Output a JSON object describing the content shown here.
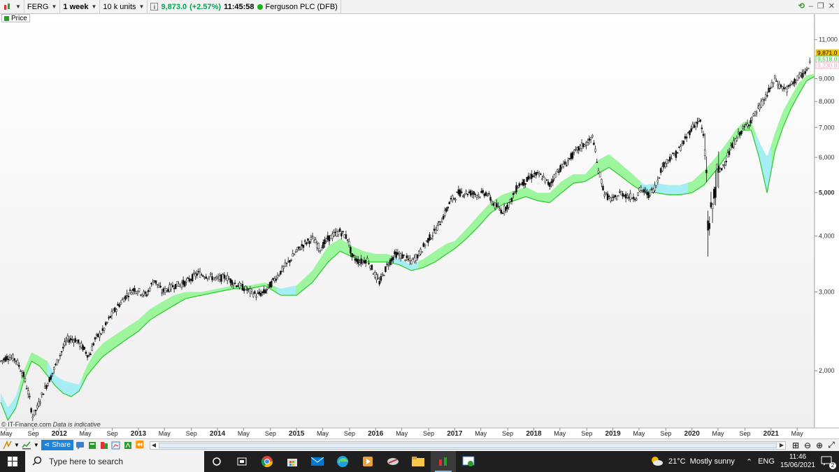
{
  "toolbar": {
    "symbol": "FERG",
    "interval": "1 week",
    "units": "10 k units",
    "info_icon": "i",
    "last_price": "9,873.0",
    "change": "(+2.57%)",
    "time": "11:45:58",
    "instrument": "Ferguson PLC (DFB)"
  },
  "legend": {
    "label": "Price"
  },
  "source": {
    "text": "© IT-Finance.com",
    "note": "Data is indicative"
  },
  "bottom": {
    "share_label": "Share"
  },
  "taskbar": {
    "search_placeholder": "Type here to search",
    "weather": "21°C  Mostly sunny",
    "language": "ENG",
    "time": "11:46",
    "date": "15/06/2021",
    "notifications": "2"
  },
  "colors": {
    "accent": "#1c84d8",
    "cloud_bull": "#8df58d",
    "cloud_bear": "#a6eef5",
    "line": "#2dc82d",
    "price_badge": "#f2c500"
  },
  "chart_data": {
    "type": "candlestick",
    "scale": "log",
    "ylim": [
      1500,
      11600
    ],
    "xlim": [
      2011.25,
      2021.55
    ],
    "ytick_values": [
      2000,
      3000,
      4000,
      5000,
      6000,
      7000,
      8000,
      9000,
      11000
    ],
    "ytick_labels": [
      "2,000",
      "3,000",
      "4,000",
      "5,000",
      "6,000",
      "7,000",
      "8,000",
      "9,000",
      "11,000"
    ],
    "price_badges": [
      {
        "label": "9,871.0",
        "value": 9871,
        "color": "#f2c500"
      },
      {
        "label": "9,518.0",
        "value": 9518,
        "color": "#2dc82d"
      },
      {
        "label": "9,230.8",
        "value": 9230,
        "color": "#f2a0c8"
      }
    ],
    "xticks": [
      {
        "label": "May",
        "x": 2011.33
      },
      {
        "label": "Sep",
        "x": 2011.67
      },
      {
        "label": "2012",
        "x": 2012.0,
        "major": true
      },
      {
        "label": "May",
        "x": 2012.33
      },
      {
        "label": "Sep",
        "x": 2012.67
      },
      {
        "label": "2013",
        "x": 2013.0,
        "major": true
      },
      {
        "label": "May",
        "x": 2013.33
      },
      {
        "label": "Sep",
        "x": 2013.67
      },
      {
        "label": "2014",
        "x": 2014.0,
        "major": true
      },
      {
        "label": "May",
        "x": 2014.33
      },
      {
        "label": "Sep",
        "x": 2014.67
      },
      {
        "label": "2015",
        "x": 2015.0,
        "major": true
      },
      {
        "label": "May",
        "x": 2015.33
      },
      {
        "label": "Sep",
        "x": 2015.67
      },
      {
        "label": "2016",
        "x": 2016.0,
        "major": true
      },
      {
        "label": "May",
        "x": 2016.33
      },
      {
        "label": "Sep",
        "x": 2016.67
      },
      {
        "label": "2017",
        "x": 2017.0,
        "major": true
      },
      {
        "label": "May",
        "x": 2017.33
      },
      {
        "label": "Sep",
        "x": 2017.67
      },
      {
        "label": "2018",
        "x": 2018.0,
        "major": true
      },
      {
        "label": "May",
        "x": 2018.33
      },
      {
        "label": "Sep",
        "x": 2018.67
      },
      {
        "label": "2019",
        "x": 2019.0,
        "major": true
      },
      {
        "label": "May",
        "x": 2019.33
      },
      {
        "label": "Sep",
        "x": 2019.67
      },
      {
        "label": "2020",
        "x": 2020.0,
        "major": true
      },
      {
        "label": "May",
        "x": 2020.33
      },
      {
        "label": "Sep",
        "x": 2020.67
      },
      {
        "label": "2021",
        "x": 2021.0,
        "major": true
      },
      {
        "label": "May",
        "x": 2021.33
      }
    ],
    "price_path": [
      [
        2011.26,
        2100
      ],
      [
        2011.35,
        2150
      ],
      [
        2011.45,
        2120
      ],
      [
        2011.55,
        1950
      ],
      [
        2011.62,
        1750
      ],
      [
        2011.66,
        1580
      ],
      [
        2011.72,
        1650
      ],
      [
        2011.8,
        1800
      ],
      [
        2011.9,
        1950
      ],
      [
        2012.0,
        2150
      ],
      [
        2012.1,
        2350
      ],
      [
        2012.2,
        2350
      ],
      [
        2012.3,
        2250
      ],
      [
        2012.38,
        2150
      ],
      [
        2012.45,
        2350
      ],
      [
        2012.55,
        2450
      ],
      [
        2012.65,
        2650
      ],
      [
        2012.75,
        2800
      ],
      [
        2012.85,
        2950
      ],
      [
        2012.95,
        3050
      ],
      [
        2013.1,
        2950
      ],
      [
        2013.2,
        3200
      ],
      [
        2013.3,
        3000
      ],
      [
        2013.45,
        3100
      ],
      [
        2013.6,
        3150
      ],
      [
        2013.75,
        3300
      ],
      [
        2013.9,
        3250
      ],
      [
        2014.0,
        3200
      ],
      [
        2014.1,
        3250
      ],
      [
        2014.2,
        3150
      ],
      [
        2014.35,
        3050
      ],
      [
        2014.5,
        2950
      ],
      [
        2014.6,
        3000
      ],
      [
        2014.75,
        3250
      ],
      [
        2014.9,
        3500
      ],
      [
        2015.0,
        3700
      ],
      [
        2015.1,
        3850
      ],
      [
        2015.2,
        3950
      ],
      [
        2015.3,
        3750
      ],
      [
        2015.4,
        3950
      ],
      [
        2015.5,
        4050
      ],
      [
        2015.55,
        4100
      ],
      [
        2015.65,
        3950
      ],
      [
        2015.7,
        3600
      ],
      [
        2015.8,
        3500
      ],
      [
        2015.9,
        3550
      ],
      [
        2016.0,
        3250
      ],
      [
        2016.05,
        3150
      ],
      [
        2016.15,
        3450
      ],
      [
        2016.25,
        3650
      ],
      [
        2016.35,
        3600
      ],
      [
        2016.45,
        3500
      ],
      [
        2016.55,
        3650
      ],
      [
        2016.65,
        3900
      ],
      [
        2016.75,
        4100
      ],
      [
        2016.85,
        4400
      ],
      [
        2016.95,
        4800
      ],
      [
        2017.05,
        5000
      ],
      [
        2017.2,
        5000
      ],
      [
        2017.3,
        4950
      ],
      [
        2017.4,
        5000
      ],
      [
        2017.5,
        4700
      ],
      [
        2017.6,
        4550
      ],
      [
        2017.7,
        4750
      ],
      [
        2017.8,
        5200
      ],
      [
        2017.9,
        5300
      ],
      [
        2018.0,
        5500
      ],
      [
        2018.1,
        5450
      ],
      [
        2018.2,
        5200
      ],
      [
        2018.3,
        5600
      ],
      [
        2018.4,
        5800
      ],
      [
        2018.5,
        6100
      ],
      [
        2018.6,
        6350
      ],
      [
        2018.7,
        6500
      ],
      [
        2018.75,
        6700
      ],
      [
        2018.8,
        5800
      ],
      [
        2018.9,
        4950
      ],
      [
        2019.0,
        4800
      ],
      [
        2019.1,
        5000
      ],
      [
        2019.2,
        4900
      ],
      [
        2019.3,
        4900
      ],
      [
        2019.35,
        5100
      ],
      [
        2019.45,
        4950
      ],
      [
        2019.55,
        5200
      ],
      [
        2019.6,
        5600
      ],
      [
        2019.7,
        5950
      ],
      [
        2019.8,
        6100
      ],
      [
        2019.9,
        6500
      ],
      [
        2020.0,
        7000
      ],
      [
        2020.1,
        7300
      ],
      [
        2020.15,
        6600
      ],
      [
        2020.18,
        5800
      ],
      [
        2020.2,
        4200
      ],
      [
        2020.25,
        4500
      ],
      [
        2020.3,
        5300
      ],
      [
        2020.4,
        5800
      ],
      [
        2020.5,
        6300
      ],
      [
        2020.6,
        6800
      ],
      [
        2020.7,
        7100
      ],
      [
        2020.8,
        7500
      ],
      [
        2020.9,
        8000
      ],
      [
        2021.0,
        8600
      ],
      [
        2021.05,
        9000
      ],
      [
        2021.1,
        8700
      ],
      [
        2021.2,
        8500
      ],
      [
        2021.3,
        8900
      ],
      [
        2021.4,
        9200
      ],
      [
        2021.48,
        9500
      ],
      [
        2021.5,
        9871
      ]
    ],
    "cloud_upper": [
      [
        2011.26,
        1780
      ],
      [
        2011.35,
        1650
      ],
      [
        2011.45,
        1750
      ],
      [
        2011.55,
        2000
      ],
      [
        2011.65,
        2200
      ],
      [
        2011.75,
        2150
      ],
      [
        2011.85,
        2100
      ],
      [
        2011.95,
        1950
      ],
      [
        2012.05,
        1900
      ],
      [
        2012.15,
        1880
      ],
      [
        2012.25,
        1860
      ],
      [
        2012.35,
        2050
      ],
      [
        2012.45,
        2200
      ],
      [
        2012.55,
        2300
      ],
      [
        2012.7,
        2400
      ],
      [
        2012.85,
        2500
      ],
      [
        2013.0,
        2600
      ],
      [
        2013.15,
        2750
      ],
      [
        2013.3,
        2850
      ],
      [
        2013.45,
        2950
      ],
      [
        2013.6,
        3000
      ],
      [
        2013.8,
        3000
      ],
      [
        2014.0,
        3050
      ],
      [
        2014.2,
        3100
      ],
      [
        2014.4,
        3100
      ],
      [
        2014.6,
        3150
      ],
      [
        2014.8,
        3050
      ],
      [
        2015.0,
        3100
      ],
      [
        2015.2,
        3350
      ],
      [
        2015.4,
        3800
      ],
      [
        2015.55,
        3950
      ],
      [
        2015.7,
        3800
      ],
      [
        2015.85,
        3700
      ],
      [
        2016.0,
        3650
      ],
      [
        2016.15,
        3650
      ],
      [
        2016.3,
        3550
      ],
      [
        2016.45,
        3450
      ],
      [
        2016.6,
        3550
      ],
      [
        2016.75,
        3700
      ],
      [
        2016.9,
        3850
      ],
      [
        2017.0,
        3900
      ],
      [
        2017.15,
        4150
      ],
      [
        2017.3,
        4450
      ],
      [
        2017.45,
        4750
      ],
      [
        2017.6,
        4950
      ],
      [
        2017.75,
        5050
      ],
      [
        2017.9,
        5150
      ],
      [
        2018.05,
        5000
      ],
      [
        2018.2,
        5000
      ],
      [
        2018.35,
        5300
      ],
      [
        2018.5,
        5500
      ],
      [
        2018.65,
        5500
      ],
      [
        2018.8,
        5900
      ],
      [
        2018.95,
        6100
      ],
      [
        2019.1,
        5800
      ],
      [
        2019.25,
        5500
      ],
      [
        2019.4,
        5200
      ],
      [
        2019.55,
        5250
      ],
      [
        2019.7,
        5200
      ],
      [
        2019.85,
        5200
      ],
      [
        2020.0,
        5300
      ],
      [
        2020.15,
        5600
      ],
      [
        2020.3,
        6000
      ],
      [
        2020.45,
        6500
      ],
      [
        2020.55,
        6900
      ],
      [
        2020.65,
        7200
      ],
      [
        2020.75,
        7200
      ],
      [
        2020.85,
        6500
      ],
      [
        2020.95,
        6000
      ],
      [
        2021.05,
        6800
      ],
      [
        2021.15,
        7600
      ],
      [
        2021.25,
        8200
      ],
      [
        2021.35,
        8800
      ],
      [
        2021.45,
        9150
      ],
      [
        2021.55,
        9230
      ]
    ],
    "cloud_lower": [
      [
        2011.26,
        1700
      ],
      [
        2011.35,
        1550
      ],
      [
        2011.45,
        1650
      ],
      [
        2011.55,
        1900
      ],
      [
        2011.65,
        2100
      ],
      [
        2011.75,
        2050
      ],
      [
        2011.85,
        1950
      ],
      [
        2011.95,
        1850
      ],
      [
        2012.05,
        1780
      ],
      [
        2012.15,
        1750
      ],
      [
        2012.25,
        1800
      ],
      [
        2012.35,
        1950
      ],
      [
        2012.45,
        2050
      ],
      [
        2012.55,
        2150
      ],
      [
        2012.7,
        2250
      ],
      [
        2012.85,
        2350
      ],
      [
        2013.0,
        2450
      ],
      [
        2013.15,
        2600
      ],
      [
        2013.3,
        2700
      ],
      [
        2013.45,
        2800
      ],
      [
        2013.6,
        2900
      ],
      [
        2013.8,
        2950
      ],
      [
        2014.0,
        3000
      ],
      [
        2014.2,
        3050
      ],
      [
        2014.4,
        3050
      ],
      [
        2014.6,
        3100
      ],
      [
        2014.8,
        2950
      ],
      [
        2015.0,
        2950
      ],
      [
        2015.2,
        3150
      ],
      [
        2015.4,
        3500
      ],
      [
        2015.55,
        3700
      ],
      [
        2015.7,
        3600
      ],
      [
        2015.85,
        3500
      ],
      [
        2016.0,
        3500
      ],
      [
        2016.15,
        3500
      ],
      [
        2016.3,
        3450
      ],
      [
        2016.45,
        3350
      ],
      [
        2016.6,
        3400
      ],
      [
        2016.75,
        3500
      ],
      [
        2016.9,
        3650
      ],
      [
        2017.0,
        3750
      ],
      [
        2017.15,
        3950
      ],
      [
        2017.3,
        4200
      ],
      [
        2017.45,
        4500
      ],
      [
        2017.6,
        4700
      ],
      [
        2017.75,
        4800
      ],
      [
        2017.9,
        4900
      ],
      [
        2018.05,
        4800
      ],
      [
        2018.2,
        4750
      ],
      [
        2018.35,
        5000
      ],
      [
        2018.5,
        5250
      ],
      [
        2018.65,
        5300
      ],
      [
        2018.8,
        5500
      ],
      [
        2018.95,
        5700
      ],
      [
        2019.1,
        5450
      ],
      [
        2019.25,
        5200
      ],
      [
        2019.4,
        5000
      ],
      [
        2019.55,
        5000
      ],
      [
        2019.7,
        4950
      ],
      [
        2019.85,
        4950
      ],
      [
        2020.0,
        5000
      ],
      [
        2020.15,
        5200
      ],
      [
        2020.3,
        5600
      ],
      [
        2020.45,
        6100
      ],
      [
        2020.55,
        6500
      ],
      [
        2020.65,
        6900
      ],
      [
        2020.75,
        6900
      ],
      [
        2020.85,
        6000
      ],
      [
        2020.95,
        5000
      ],
      [
        2021.05,
        6200
      ],
      [
        2021.15,
        7000
      ],
      [
        2021.25,
        7700
      ],
      [
        2021.35,
        8300
      ],
      [
        2021.45,
        8900
      ],
      [
        2021.55,
        9100
      ]
    ],
    "bear_regions": [
      [
        2011.26,
        2011.5
      ],
      [
        2011.85,
        2012.3
      ],
      [
        2014.75,
        2015.0
      ],
      [
        2016.2,
        2016.55
      ],
      [
        2019.35,
        2019.95
      ],
      [
        2020.8,
        2021.0
      ]
    ]
  }
}
